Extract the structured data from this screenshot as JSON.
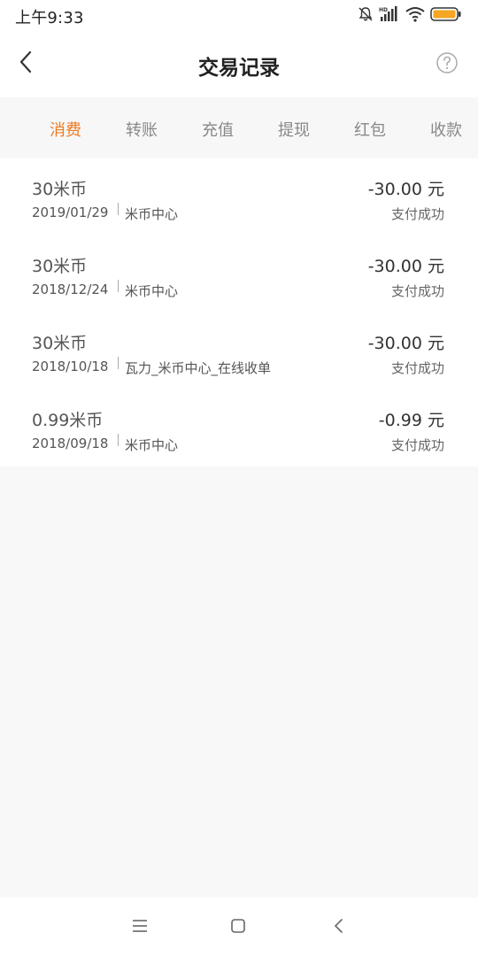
{
  "status_bar": {
    "time": "上午9:33",
    "icons": [
      "mute-bell-icon",
      "hd-signal-icon",
      "wifi-icon",
      "battery-icon"
    ],
    "battery_color": "#f5a623"
  },
  "header": {
    "title": "交易记录",
    "back_icon": "chevron-left-icon",
    "help_icon": "question-circle-icon"
  },
  "tabs": [
    {
      "label": "消费",
      "active": true
    },
    {
      "label": "转账",
      "active": false
    },
    {
      "label": "充值",
      "active": false
    },
    {
      "label": "提现",
      "active": false
    },
    {
      "label": "红包",
      "active": false
    },
    {
      "label": "收款",
      "active": false
    }
  ],
  "accent_color": "#ee7a1f",
  "transactions": [
    {
      "name": "30米币",
      "date": "2019/01/29",
      "merchant": "米币中心",
      "amount": "-30.00 元",
      "status": "支付成功"
    },
    {
      "name": "30米币",
      "date": "2018/12/24",
      "merchant": "米币中心",
      "amount": "-30.00 元",
      "status": "支付成功"
    },
    {
      "name": "30米币",
      "date": "2018/10/18",
      "merchant": "瓦力_米币中心_在线收单",
      "amount": "-30.00 元",
      "status": "支付成功"
    },
    {
      "name": "0.99米币",
      "date": "2018/09/18",
      "merchant": "米币中心",
      "amount": "-0.99 元",
      "status": "支付成功"
    }
  ],
  "nav_bar": {
    "icons": [
      "menu-icon",
      "home-square-icon",
      "back-triangle-icon"
    ]
  }
}
